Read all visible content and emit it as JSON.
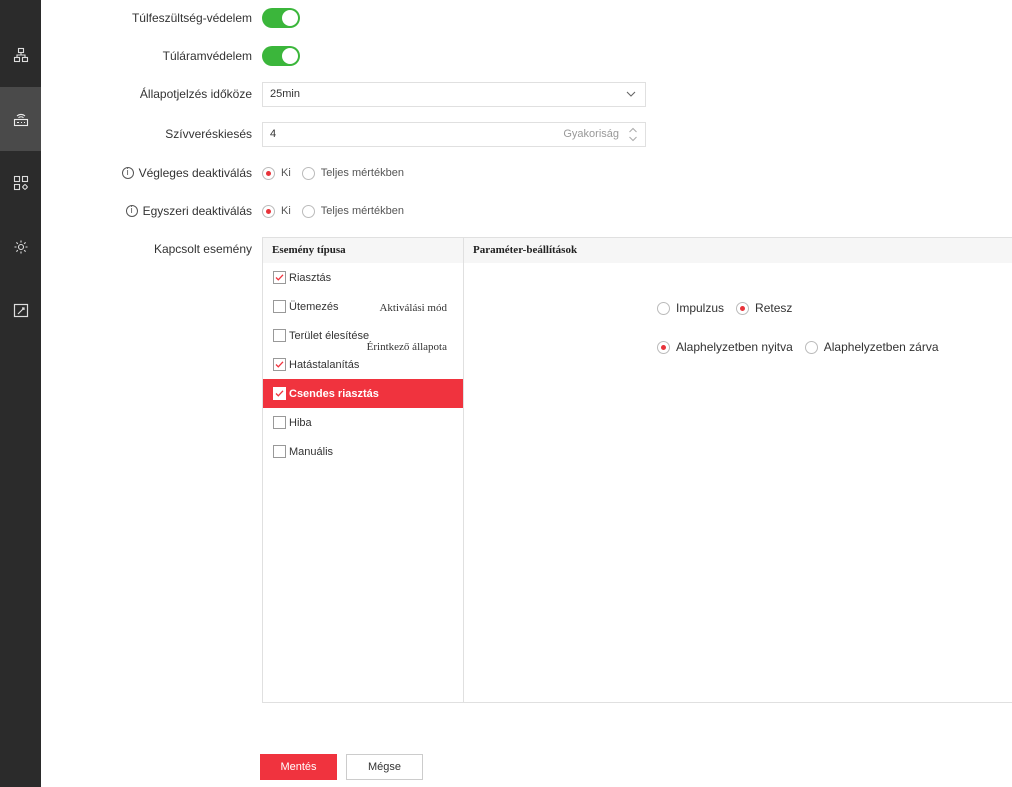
{
  "sidebar": {
    "items": [
      {
        "icon": "network-topology-icon"
      },
      {
        "icon": "device-module-icon",
        "active": true
      },
      {
        "icon": "app-grid-settings-icon"
      },
      {
        "icon": "gear-icon"
      },
      {
        "icon": "maintenance-screen-icon"
      }
    ]
  },
  "form": {
    "overvoltage": {
      "label": "Túlfeszültség-védelem",
      "enabled": true
    },
    "overcurrent": {
      "label": "Túláramvédelem",
      "enabled": true
    },
    "status_interval": {
      "label": "Állapotjelzés időköze",
      "value": "25min"
    },
    "heartbeat": {
      "label": "Szívveréskiesés",
      "value": "4",
      "unit": "Gyakoriság"
    },
    "permanent_deactivation": {
      "label": "Végleges deaktiválás",
      "options": [
        "Ki",
        "Teljes mértékben"
      ],
      "selected": "Ki"
    },
    "single_deactivation": {
      "label": "Egyszeri deaktiválás",
      "options": [
        "Ki",
        "Teljes mértékben"
      ],
      "selected": "Ki"
    },
    "linked_event_label": "Kapcsolt esemény"
  },
  "event_table": {
    "col_event_type": "Esemény típusa",
    "col_params": "Paraméter-beállítások",
    "events": [
      {
        "label": "Riasztás",
        "checked": true,
        "selected": false
      },
      {
        "label": "Ütemezés",
        "checked": false,
        "selected": false
      },
      {
        "label": "Terület élesítése",
        "checked": false,
        "selected": false
      },
      {
        "label": "Hatástalanítás",
        "checked": true,
        "selected": false
      },
      {
        "label": "Csendes riasztás",
        "checked": true,
        "selected": true
      },
      {
        "label": "Hiba",
        "checked": false,
        "selected": false
      },
      {
        "label": "Manuális",
        "checked": false,
        "selected": false
      }
    ],
    "params": {
      "activation_mode": {
        "label": "Aktiválási mód",
        "options": [
          "Impulzus",
          "Retesz"
        ],
        "selected": "Retesz"
      },
      "contact_state": {
        "label": "Érintkező állapota",
        "options": [
          "Alaphelyzetben nyitva",
          "Alaphelyzetben zárva"
        ],
        "selected": "Alaphelyzetben nyitva"
      }
    }
  },
  "buttons": {
    "save": "Mentés",
    "cancel": "Mégse"
  },
  "colors": {
    "accent": "#f0333e",
    "toggle_on": "#3bb63b",
    "sidebar": "#2b2b2b"
  }
}
